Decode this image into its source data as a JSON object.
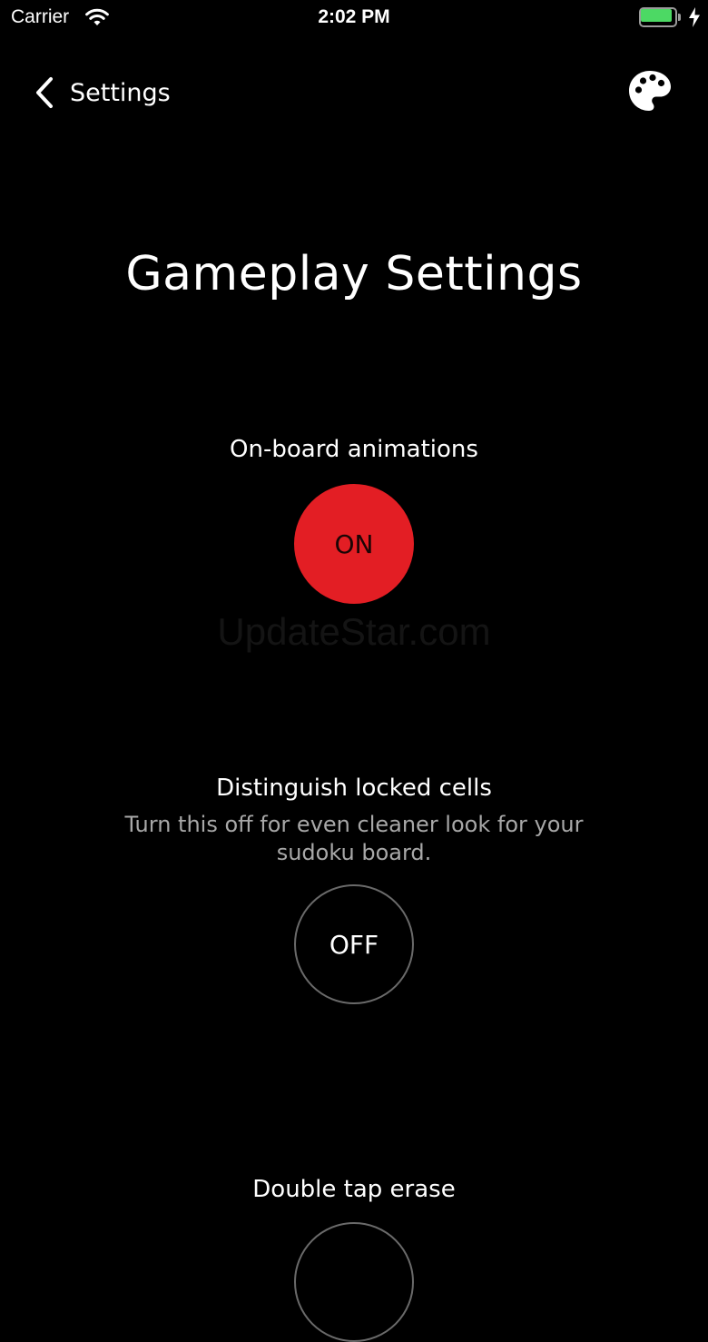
{
  "status_bar": {
    "carrier": "Carrier",
    "time": "2:02 PM",
    "battery_color": "#4cd964"
  },
  "nav": {
    "back_label": "Settings",
    "back_icon": "chevron-left-icon",
    "right_icon": "palette-icon"
  },
  "page": {
    "title": "Gameplay Settings"
  },
  "settings": [
    {
      "label": "On-board animations",
      "description": "",
      "state": "ON",
      "accent_color": "#e31e24"
    },
    {
      "label": "Distinguish locked cells",
      "description": "Turn this off for even cleaner look for your sudoku board.",
      "state": "OFF"
    },
    {
      "label": "Double tap erase",
      "description": "",
      "state": ""
    }
  ],
  "watermark": "UpdateStar.com"
}
